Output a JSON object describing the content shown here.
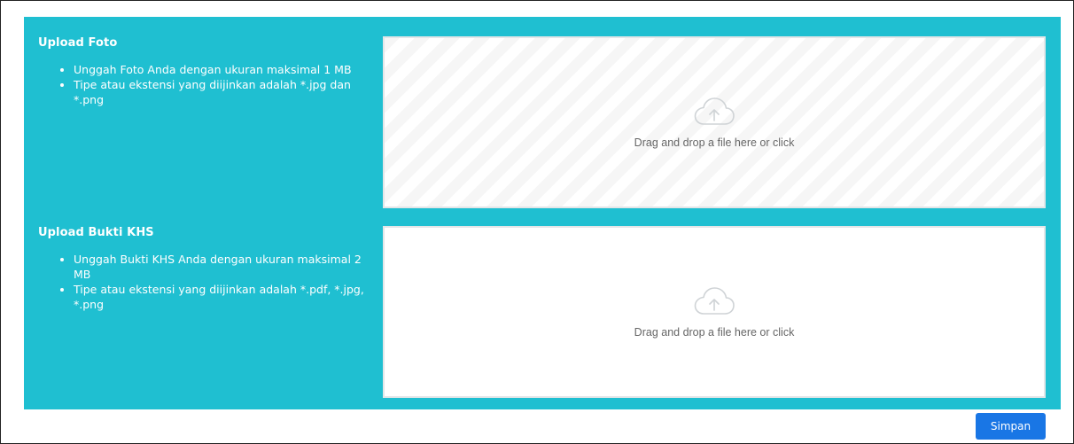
{
  "photo_upload": {
    "title": "Upload Foto",
    "notes": [
      "Unggah Foto Anda dengan ukuran maksimal 1 MB",
      "Tipe atau ekstensi yang diijinkan adalah *.jpg dan *.png"
    ],
    "dropzone_text": "Drag and drop a file here or click",
    "icon": "cloud-upload-icon"
  },
  "khs_upload": {
    "title": "Upload Bukti KHS",
    "notes": [
      "Unggah Bukti KHS Anda dengan ukuran maksimal 2 MB",
      "Tipe atau ekstensi yang diijinkan adalah *.pdf, *.jpg, *.png"
    ],
    "dropzone_text": "Drag and drop a file here or click",
    "icon": "cloud-upload-icon"
  },
  "actions": {
    "save_label": "Simpan"
  },
  "colors": {
    "panel": "#1fbfd1",
    "primary_button": "#1976e5"
  }
}
